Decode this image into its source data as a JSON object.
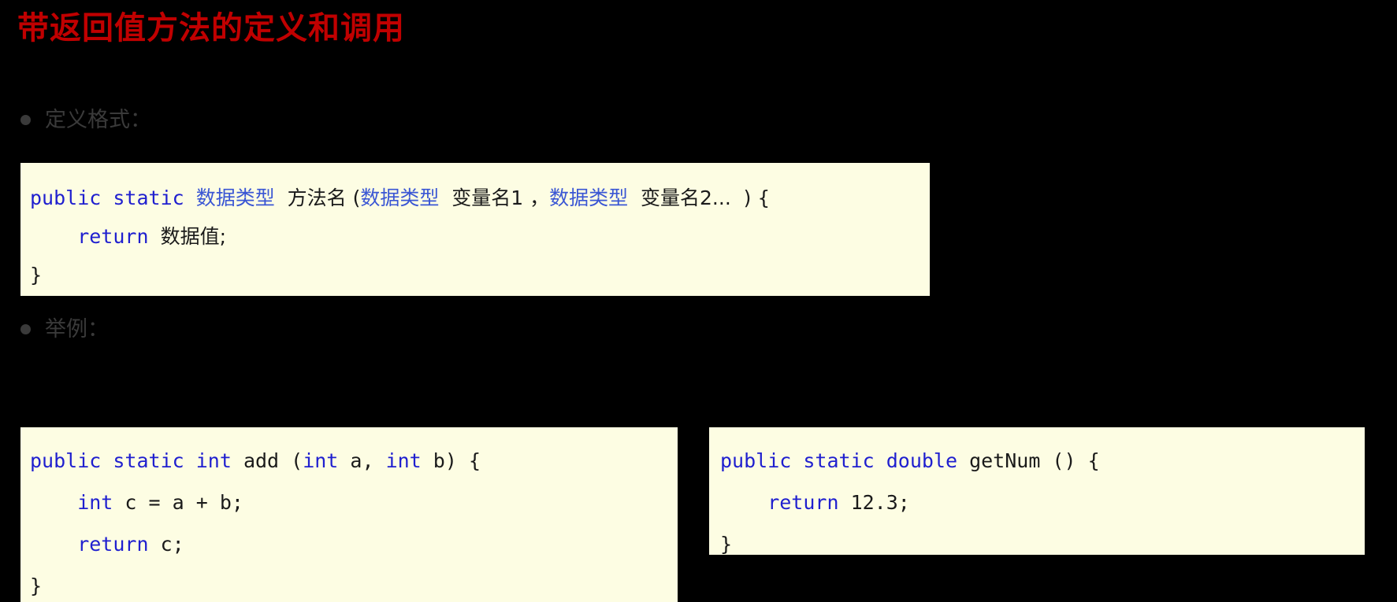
{
  "slide": {
    "title": "带返回值方法的定义和调用",
    "title_color": "#C00000",
    "background_color": "#000000"
  },
  "bullets": [
    {
      "label": "定义格式：",
      "bullet_glyph": "filled-circle"
    },
    {
      "label": "举例：",
      "bullet_glyph": "filled-circle"
    }
  ],
  "code_blocks": {
    "format": {
      "background_color": "#FDFDE3",
      "keyword_color": "#1F1FCF",
      "lines": {
        "l1_kw": "public static ",
        "l1_type": "数据类型",
        "l1_name": "  方法名 (",
        "l1_type2": "数据类型",
        "l1_var1": "  变量名1 ，",
        "l1_type3": "数据类型",
        "l1_var2": "  变量名2...  ) {",
        "l2_kw": "    return ",
        "l2_val": "数据值;",
        "l3": "}"
      }
    },
    "add": {
      "background_color": "#FDFDE3",
      "lines": {
        "l1_kw": "public static int ",
        "l1_rest": "add (",
        "l1_kw2": "int",
        "l1_rest2": " a, ",
        "l1_kw3": "int",
        "l1_rest3": " b) {",
        "l2_kw": "    int ",
        "l2_rest": "c = a + b;",
        "l3_kw": "    return ",
        "l3_rest": "c;",
        "l4": "}"
      }
    },
    "getnum": {
      "background_color": "#FDFDE3",
      "lines": {
        "l1_kw": "public static double ",
        "l1_rest": "getNum () {",
        "l2_kw": "    return ",
        "l2_rest": "12.3;",
        "l3": "}"
      }
    }
  }
}
